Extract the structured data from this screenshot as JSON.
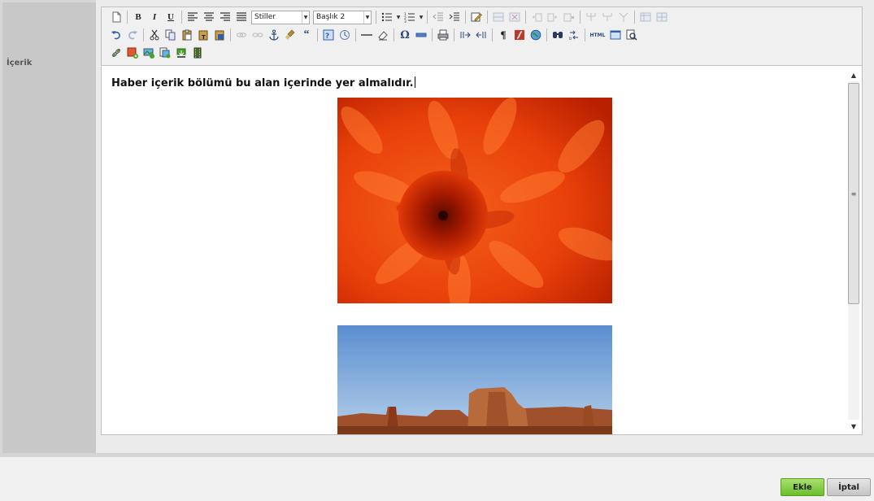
{
  "form": {
    "field_label": "İçerik"
  },
  "toolbar": {
    "row1": {
      "style_combo_value": "Stiller",
      "format_combo_value": "Başlık 2",
      "bold_label": "B",
      "italic_label": "I",
      "underline_label": "U"
    },
    "row2": {
      "omega_label": "Ω",
      "pilcrow_label": "¶",
      "html_label": "HTML",
      "quote_label": "“"
    }
  },
  "content": {
    "heading_text": "Haber içerik bölümü bu alan içerinde yer almalıdır."
  },
  "buttons": {
    "add_label": "Ekle",
    "cancel_label": "İptal"
  },
  "colors": {
    "add_button": "#7cc83a",
    "cancel_button": "#d0d0d0",
    "label_column": "#c8c8c8"
  }
}
